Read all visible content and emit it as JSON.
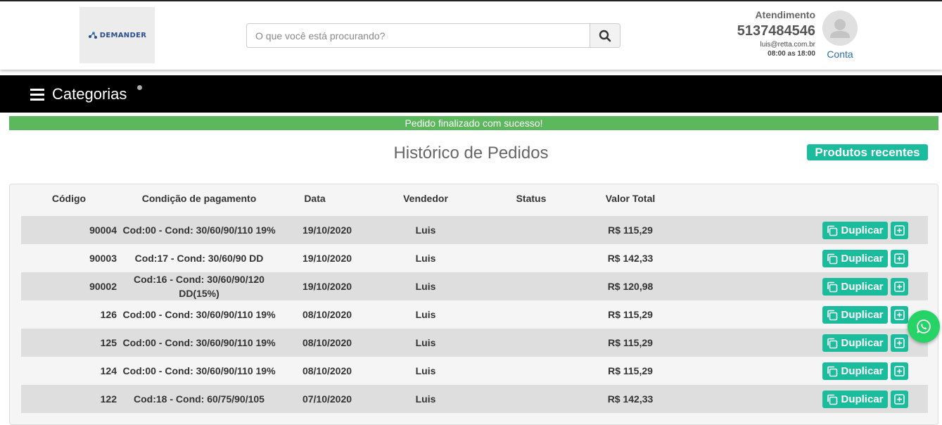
{
  "header": {
    "logo_text": "DEMANDER",
    "search": {
      "placeholder": "O que você está procurando?",
      "value": ""
    },
    "contact": {
      "label": "Atendimento",
      "phone": "5137484546",
      "email": "luis@retta.com.br",
      "hours": "08:00 as 18:00"
    },
    "account_label": "Conta"
  },
  "navbar": {
    "categories_label": "Categorias"
  },
  "alert": {
    "text": "Pedido finalizado com sucesso!",
    "color": "#5cb85c"
  },
  "page": {
    "title": "Histórico de Pedidos",
    "recent_products_label": "Produtos recentes"
  },
  "table": {
    "headers": {
      "code": "Código",
      "payment": "Condição de pagamento",
      "date": "Data",
      "seller": "Vendedor",
      "status": "Status",
      "total": "Valor Total"
    },
    "rows": [
      {
        "code": "90004",
        "payment": "Cod:00 - Cond: 30/60/90/110 19%",
        "date": "19/10/2020",
        "seller": "Luis",
        "status": "",
        "total": "R$ 115,29"
      },
      {
        "code": "90003",
        "payment": "Cod:17 - Cond: 30/60/90 DD",
        "date": "19/10/2020",
        "seller": "Luis",
        "status": "",
        "total": "R$ 142,33"
      },
      {
        "code": "90002",
        "payment": "Cod:16 - Cond: 30/60/90/120 DD(15%)",
        "date": "19/10/2020",
        "seller": "Luis",
        "status": "",
        "total": "R$ 120,98"
      },
      {
        "code": "126",
        "payment": "Cod:00 - Cond: 30/60/90/110 19%",
        "date": "08/10/2020",
        "seller": "Luis",
        "status": "",
        "total": "R$ 115,29"
      },
      {
        "code": "125",
        "payment": "Cod:00 - Cond: 30/60/90/110 19%",
        "date": "08/10/2020",
        "seller": "Luis",
        "status": "",
        "total": "R$ 115,29"
      },
      {
        "code": "124",
        "payment": "Cod:00 - Cond: 30/60/90/110 19%",
        "date": "08/10/2020",
        "seller": "Luis",
        "status": "",
        "total": "R$ 115,29"
      },
      {
        "code": "122",
        "payment": "Cod:18 - Cond: 60/75/90/105",
        "date": "07/10/2020",
        "seller": "Luis",
        "status": "",
        "total": "R$ 142,33"
      }
    ],
    "duplicate_label": "Duplicar"
  },
  "colors": {
    "accent": "#1abc9c",
    "navbar": "#000000",
    "link": "#2a6fa8"
  },
  "icons": {
    "search": "magnifier-icon",
    "menu": "hamburger-icon",
    "avatar": "user-icon",
    "duplicate": "copy-icon",
    "add": "plus-square-icon",
    "chat": "whatsapp-icon"
  }
}
